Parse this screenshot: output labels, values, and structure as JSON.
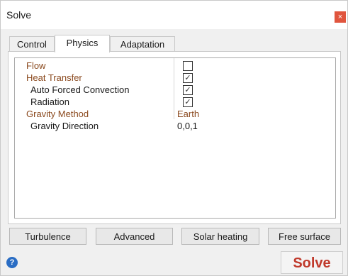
{
  "window": {
    "title": "Solve",
    "close_glyph": "×"
  },
  "tabs": [
    {
      "label": "Control"
    },
    {
      "label": "Physics",
      "active": true
    },
    {
      "label": "Adaptation"
    }
  ],
  "properties": [
    {
      "label": "Flow",
      "kind": "category",
      "value_type": "checkbox",
      "checked": false
    },
    {
      "label": "Heat Transfer",
      "kind": "category",
      "value_type": "checkbox",
      "checked": true
    },
    {
      "label": "Auto Forced Convection",
      "kind": "sub",
      "value_type": "checkbox",
      "checked": true
    },
    {
      "label": "Radiation",
      "kind": "sub",
      "value_type": "checkbox",
      "checked": true
    },
    {
      "label": "Gravity Method",
      "kind": "category",
      "value_type": "text",
      "value": "Earth"
    },
    {
      "label": "Gravity Direction",
      "kind": "sub",
      "value_type": "text",
      "value": "0,0,1"
    }
  ],
  "buttons": {
    "turbulence": "Turbulence",
    "advanced": "Advanced",
    "solar_heating": "Solar heating",
    "free_surface": "Free surface"
  },
  "footer": {
    "help_glyph": "?",
    "solve": "Solve"
  },
  "colors": {
    "category_text": "#8b4a1f",
    "solve_text": "#c0392b",
    "close_bg": "#e0553e",
    "help_bg": "#2a6dc4"
  },
  "icons": {
    "close": "close-icon",
    "help": "help-icon",
    "check": "checkmark-icon"
  }
}
